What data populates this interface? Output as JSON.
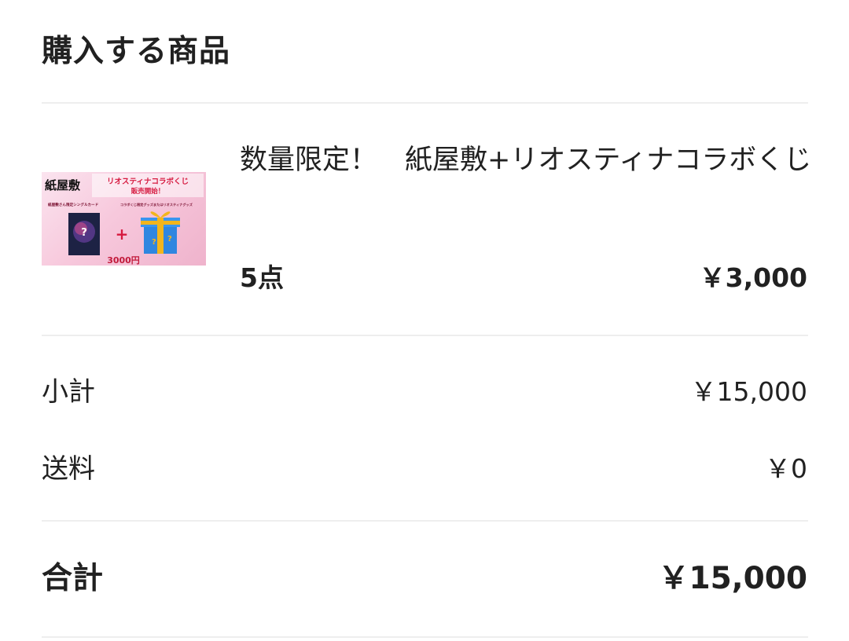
{
  "section": {
    "title": "購入する商品"
  },
  "product": {
    "name": "数量限定！　紙屋敷+リオスティナコラボくじ",
    "quantity": "5点",
    "price": "￥3,000",
    "thumbnail": {
      "logo_text": "紙屋敷",
      "banner_text": "リオスティナコラボくじ",
      "banner_subtext": "販売開始！",
      "left_caption": "紙屋敷さん限定シングルカード",
      "right_caption": "コラボくじ限定グッズまたはリオスティナグッズ",
      "plus_sign": "+",
      "price_tag": "3000円",
      "colors": {
        "background": "#f7c8dc",
        "banner_red": "#d6193f",
        "gift_blue": "#2f86e0",
        "ribbon_gold": "#f2b51c"
      }
    }
  },
  "summary": {
    "subtotal_label": "小計",
    "subtotal_value": "￥15,000",
    "shipping_label": "送料",
    "shipping_value": "￥0",
    "total_label": "合計",
    "total_value": "￥15,000"
  }
}
